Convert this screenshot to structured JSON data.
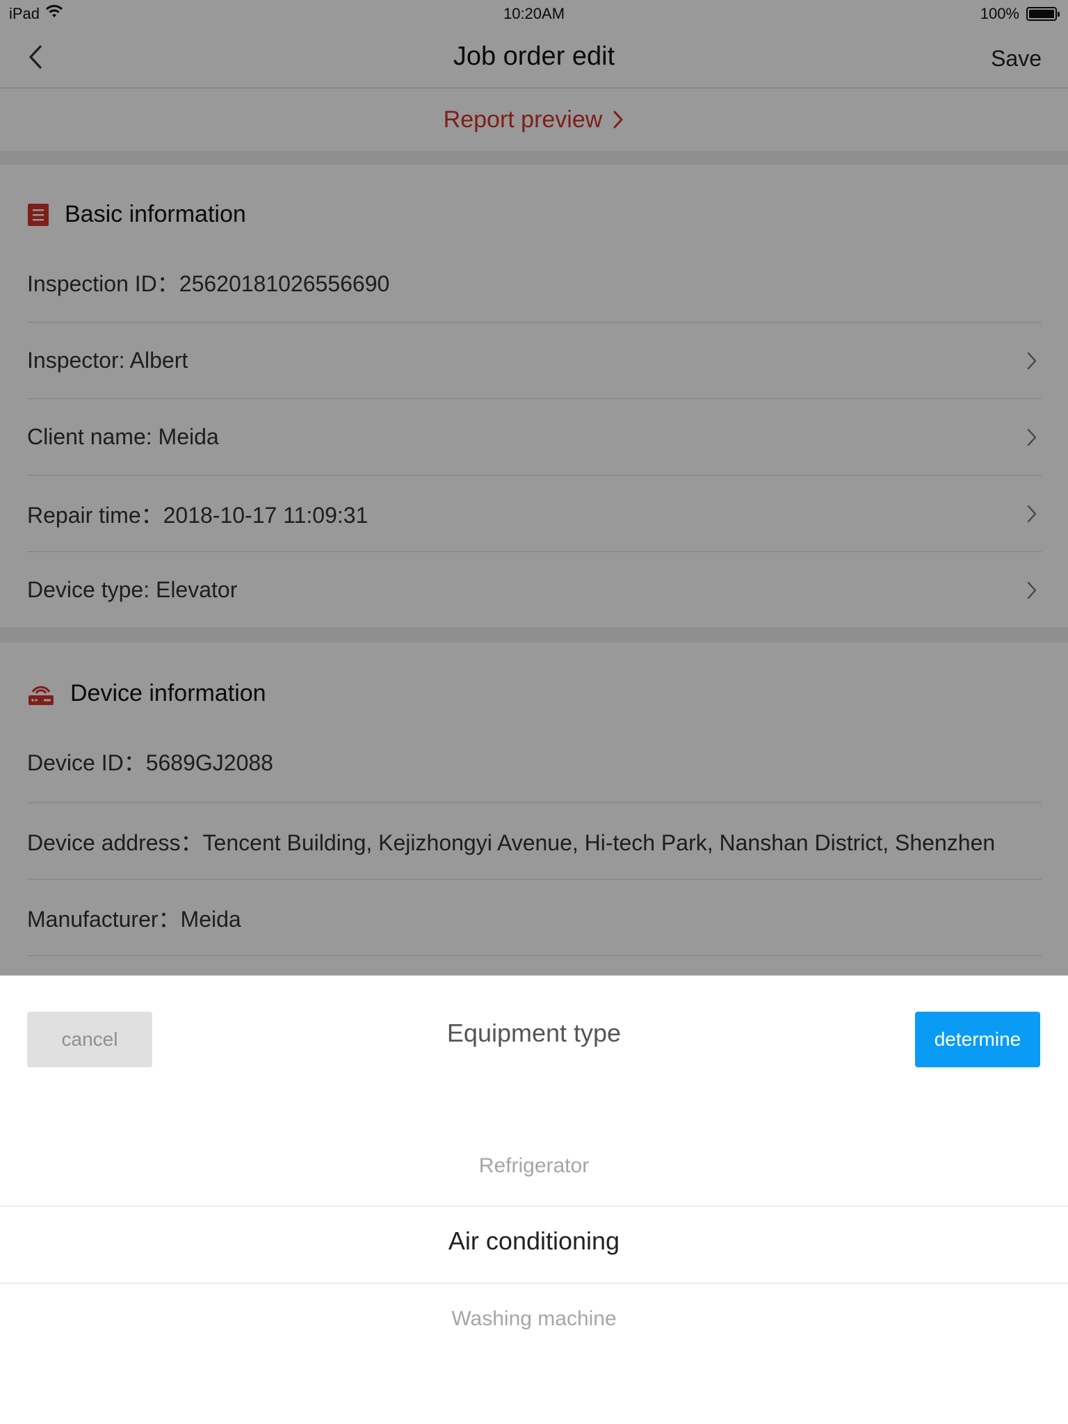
{
  "status_bar": {
    "device": "iPad",
    "time": "10:20AM",
    "battery": "100%"
  },
  "nav": {
    "title": "Job order edit",
    "save_label": "Save"
  },
  "report_preview": {
    "label": "Report preview",
    "color": "#d0342c"
  },
  "basic_info": {
    "title": "Basic information",
    "icon": "list-icon",
    "rows": [
      {
        "text": "Inspection ID：25620181026556690",
        "chevron": false
      },
      {
        "text": "Inspector: Albert",
        "chevron": true
      },
      {
        "text": "Client name: Meida",
        "chevron": true
      },
      {
        "text": "Repair time：2018-10-17 11:09:31",
        "chevron": true
      },
      {
        "text": "Device type: Elevator",
        "chevron": true
      }
    ]
  },
  "device_info": {
    "title": "Device information",
    "icon": "router-icon",
    "rows": [
      {
        "text": "Device ID：5689GJ2088"
      },
      {
        "text": "Device address：Tencent Building, Kejizhongyi Avenue, Hi-tech Park, Nanshan District, Shenzhen"
      },
      {
        "text": "Manufacturer：Meida"
      }
    ]
  },
  "picker_sheet": {
    "cancel_label": "cancel",
    "title": "Equipment type",
    "determine_label": "determine",
    "options": [
      "Refrigerator",
      "Air conditioning",
      "Washing machine"
    ],
    "selected": "Air conditioning",
    "accent_color": "#0a9cf5"
  }
}
